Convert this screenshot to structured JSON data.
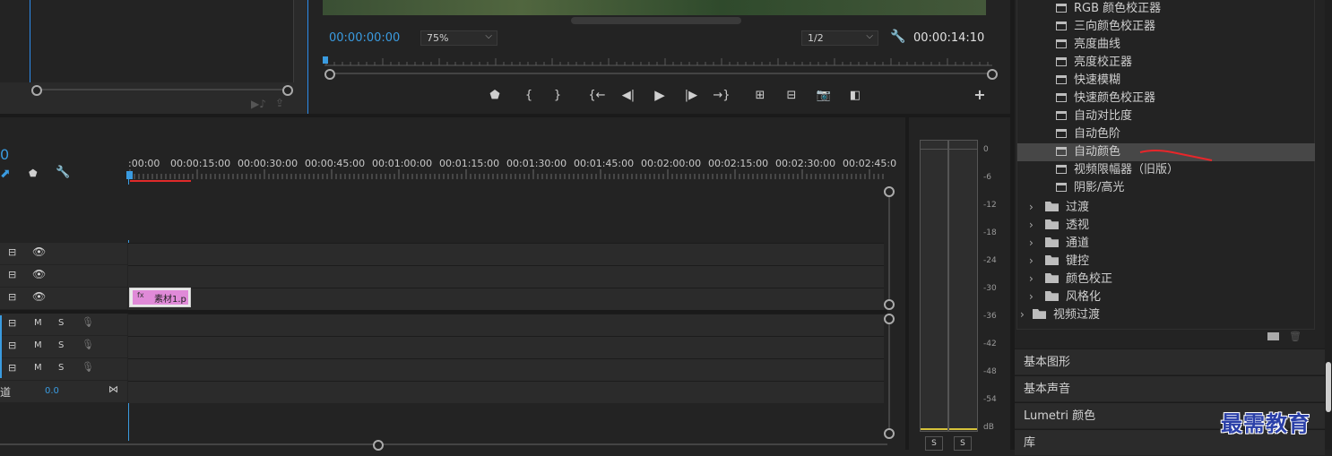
{
  "program_monitor": {
    "current_time": "00:00:00:00",
    "zoom": "75%",
    "resolution": "1/2",
    "duration": "00:00:14:10"
  },
  "transport_icons": [
    "add-marker-icon",
    "mark-in-icon",
    "mark-out-icon",
    "go-to-in-icon",
    "step-back-icon",
    "play-icon",
    "step-forward-icon",
    "go-to-out-icon",
    "lift-icon",
    "extract-icon",
    "export-frame-icon",
    "comparison-view-icon",
    "button-editor-plus-icon"
  ],
  "timeline": {
    "timecode_fragment": "0",
    "ruler_labels": [
      ":00:00",
      "00:00:15:00",
      "00:00:30:00",
      "00:00:45:00",
      "00:01:00:00",
      "00:01:15:00",
      "00:01:30:00",
      "00:01:45:00",
      "00:02:00:00",
      "00:02:15:00",
      "00:02:30:00",
      "00:02:45:0"
    ],
    "clip_name": "素材1.p",
    "audio_track_buttons": {
      "mute": "M",
      "solo": "S"
    },
    "master_label": "道",
    "master_value": "0.0"
  },
  "audio_meter": {
    "db_labels": [
      "0",
      "-6",
      "-12",
      "-18",
      "-24",
      "-30",
      "-36",
      "-42",
      "-48",
      "-54",
      "dB"
    ],
    "solo_labels": [
      "S",
      "S"
    ]
  },
  "effects_panel": {
    "items": [
      "RGB 颜色校正器",
      "三向颜色校正器",
      "亮度曲线",
      "亮度校正器",
      "快速模糊",
      "快速颜色校正器",
      "自动对比度",
      "自动色阶",
      "自动颜色",
      "视频限幅器（旧版）",
      "阴影/高光"
    ],
    "selected_index": 8,
    "folders": [
      "过渡",
      "透视",
      "通道",
      "键控",
      "颜色校正",
      "风格化"
    ],
    "top_folder": "视频过渡"
  },
  "sections": [
    "基本图形",
    "基本声音",
    "Lumetri 颜色",
    "库"
  ],
  "watermark": "最需教育",
  "colors": {
    "accent_blue": "#2d8ceb",
    "clip_pink": "#e08ad8",
    "annotation_red": "#e8262a",
    "meter_yellow": "#d6c23a"
  }
}
